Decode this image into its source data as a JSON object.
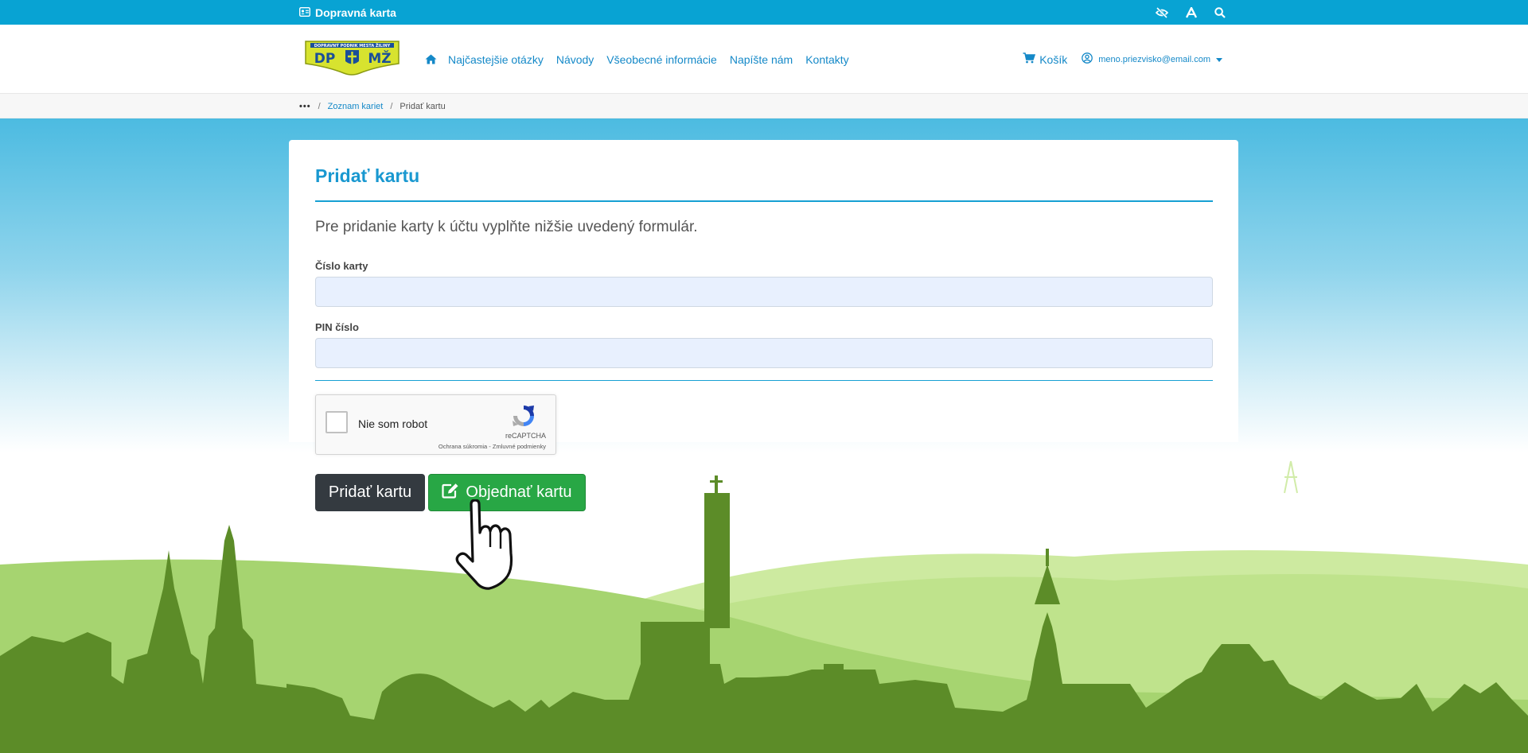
{
  "topbar": {
    "brand_label": "Dopravná karta",
    "brand_icon": "id-card-icon",
    "tools": [
      "eye-slash-icon",
      "font-size-icon",
      "search-icon"
    ]
  },
  "header": {
    "logo_text_top": "DOPRAVNÝ PODNIK MESTA ŽILINY",
    "logo_text_left": "DP",
    "logo_text_right": "MŽ",
    "nav": [
      {
        "label": "Najčastejšie otázky"
      },
      {
        "label": "Návody"
      },
      {
        "label": "Všeobecné informácie"
      },
      {
        "label": "Napíšte nám"
      },
      {
        "label": "Kontakty"
      }
    ],
    "cart_label": "Košík",
    "user_email": "meno.priezvisko@email.com"
  },
  "breadcrumb": {
    "dots": "•••",
    "items": [
      "Zoznam kariet",
      "Pridať kartu"
    ]
  },
  "form": {
    "title": "Pridať kartu",
    "intro": "Pre pridanie karty k účtu vyplňte nižšie uvedený formulár.",
    "card_number_label": "Číslo karty",
    "card_number_value": "",
    "pin_label": "PIN číslo",
    "pin_value": ""
  },
  "recaptcha": {
    "label": "Nie som robot",
    "brand": "reCAPTCHA",
    "privacy": "Ochrana súkromia",
    "separator": " - ",
    "terms": "Zmluvné podmienky"
  },
  "buttons": {
    "add_label": "Pridať kartu",
    "order_label": "Objednať kartu"
  },
  "colors": {
    "topbar": "#08a3d3",
    "link": "#1589c8",
    "title": "#1998d0",
    "btn_dark": "#343a40",
    "btn_green": "#28a745",
    "hill_dark": "#5c8c28",
    "hill_light": "#a3d36c"
  }
}
